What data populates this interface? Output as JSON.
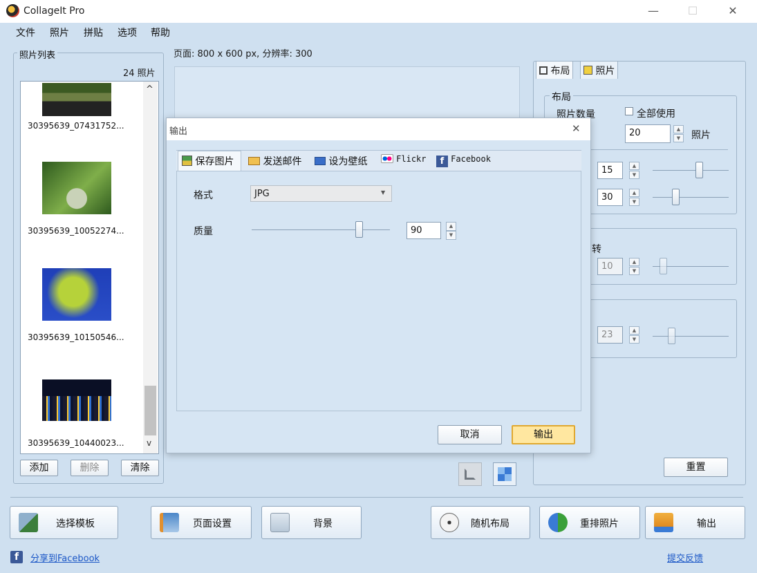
{
  "app": {
    "title": "CollageIt Pro",
    "win_min": "—",
    "win_max": "☐",
    "win_close": "✕"
  },
  "menu": [
    "文件",
    "照片",
    "拼贴",
    "选项",
    "帮助"
  ],
  "photo_panel": {
    "group_label": "照片列表",
    "count_label": "24 照片",
    "items": [
      {
        "label": "30395639_07431752...",
        "thumb_colors": [
          "#2f4a1c",
          "#6a7a3e",
          "#1f1f1f"
        ]
      },
      {
        "label": "30395639_10052274...",
        "thumb_colors": [
          "#2e5a1e",
          "#7fae4a",
          "#c9d2b8"
        ]
      },
      {
        "label": "30395639_10150546...",
        "thumb_colors": [
          "#1f3fb8",
          "#b6d23a",
          "#3a6a1e"
        ]
      },
      {
        "label": "30395639_10440023...",
        "thumb_colors": [
          "#0a0f25",
          "#ffcc33",
          "#2e6fd0"
        ]
      }
    ],
    "scroll_up": "^",
    "scroll_down": "v",
    "buttons": {
      "add": "添加",
      "delete": "删除",
      "clear": "清除"
    }
  },
  "page_info": "页面: 800 x 600 px, 分辨率: 300",
  "right_panel": {
    "tabs": {
      "layout": "布局",
      "photo": "照片"
    },
    "layout_group": "布局",
    "photo_count_label": "照片数量",
    "use_all_label": "全部使用",
    "photo_count_value": "20",
    "photo_unit": "照片",
    "spacing_value": "15",
    "margin_value": "30",
    "rotate_label": "转",
    "rotate_value": "10",
    "shadow_value": "23",
    "reset_button": "重置"
  },
  "dialog": {
    "title": "输出",
    "close": "✕",
    "tabs": [
      {
        "label": "保存图片",
        "icon": "save-image-icon"
      },
      {
        "label": "发送邮件",
        "icon": "mail-icon"
      },
      {
        "label": "设为壁纸",
        "icon": "monitor-icon"
      },
      {
        "label": "Flickr",
        "icon": "flickr-icon"
      },
      {
        "label": "Facebook",
        "icon": "facebook-icon"
      }
    ],
    "format_label": "格式",
    "format_value": "JPG",
    "quality_label": "质量",
    "quality_value": "90",
    "quality_fraction": 0.9,
    "cancel_button": "取消",
    "export_button": "输出"
  },
  "bottom_bar": {
    "select_template": "选择模板",
    "page_setup": "页面设置",
    "background": "背景",
    "random_layout": "随机布局",
    "shuffle_photos": "重排照片",
    "export": "输出"
  },
  "footer": {
    "share_facebook": "分享到Facebook",
    "feedback": "提交反馈"
  },
  "colors": {
    "accent_blue": "#1a56c6",
    "panel_bg": "#cfe0f0",
    "dialog_highlight": "#ffe7a0"
  }
}
